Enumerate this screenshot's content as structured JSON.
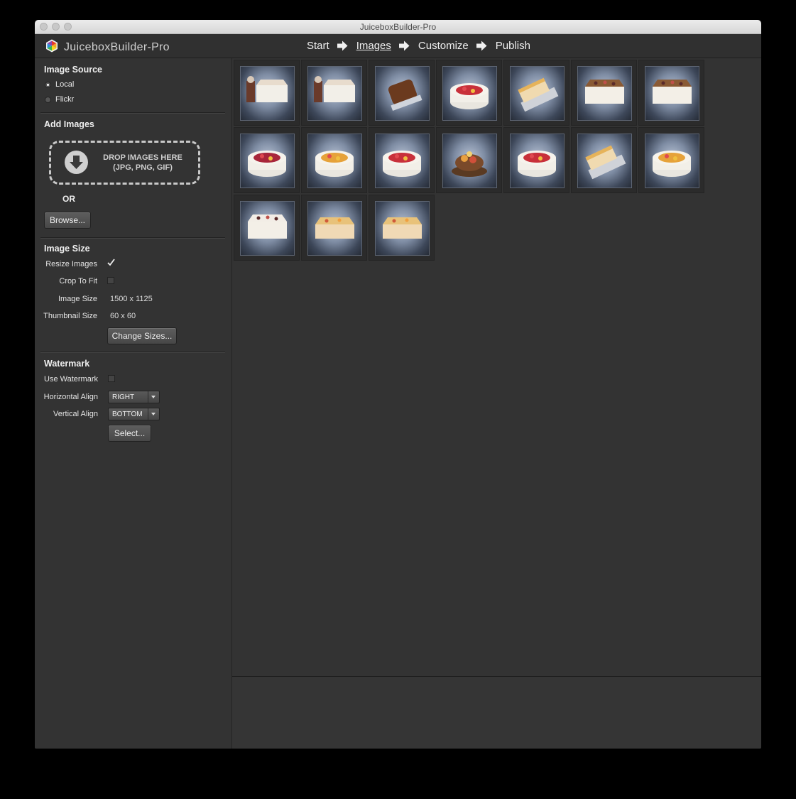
{
  "window": {
    "title": "JuiceboxBuilder-Pro"
  },
  "app": {
    "name": "JuiceboxBuilder-Pro"
  },
  "steps": [
    {
      "label": "Start",
      "active": false
    },
    {
      "label": "Images",
      "active": true
    },
    {
      "label": "Customize",
      "active": false
    },
    {
      "label": "Publish",
      "active": false
    }
  ],
  "image_source": {
    "title": "Image Source",
    "options": [
      {
        "label": "Local",
        "selected": true
      },
      {
        "label": "Flickr",
        "selected": false
      }
    ]
  },
  "add_images": {
    "title": "Add Images",
    "drop_line1": "DROP IMAGES HERE",
    "drop_line2": "(JPG, PNG, GIF)",
    "or_label": "OR",
    "browse_label": "Browse..."
  },
  "image_size": {
    "title": "Image Size",
    "resize_label": "Resize Images",
    "resize_checked": true,
    "crop_label": "Crop To Fit",
    "crop_checked": false,
    "image_size_label": "Image Size",
    "image_size_value": "1500 x 1125",
    "thumb_size_label": "Thumbnail Size",
    "thumb_size_value": "60 x 60",
    "change_label": "Change Sizes..."
  },
  "watermark": {
    "title": "Watermark",
    "use_label": "Use Watermark",
    "use_checked": false,
    "halign_label": "Horizontal Align",
    "halign_value": "RIGHT",
    "valign_label": "Vertical Align",
    "valign_value": "BOTTOM",
    "select_label": "Select..."
  },
  "thumbnails": [
    {
      "subject": "cake-log-with-figures"
    },
    {
      "subject": "cake-log-with-figures"
    },
    {
      "subject": "chocolate-roll"
    },
    {
      "subject": "strawberry-round-cake"
    },
    {
      "subject": "cream-slice"
    },
    {
      "subject": "chocolate-decorated-sheet-cake"
    },
    {
      "subject": "chocolate-decorated-sheet-cake"
    },
    {
      "subject": "berry-round-cake"
    },
    {
      "subject": "fruit-round-cake"
    },
    {
      "subject": "strawberry-round-cake"
    },
    {
      "subject": "chocolate-fruit-tart"
    },
    {
      "subject": "strawberry-round-cake"
    },
    {
      "subject": "cream-slice"
    },
    {
      "subject": "fruit-round-cake"
    },
    {
      "subject": "dotted-sheet-cake"
    },
    {
      "subject": "fruit-log-cake"
    },
    {
      "subject": "fruit-log-cake"
    }
  ],
  "colors": {
    "window_bg": "#333333",
    "accent_text": "#f0f0f0"
  }
}
